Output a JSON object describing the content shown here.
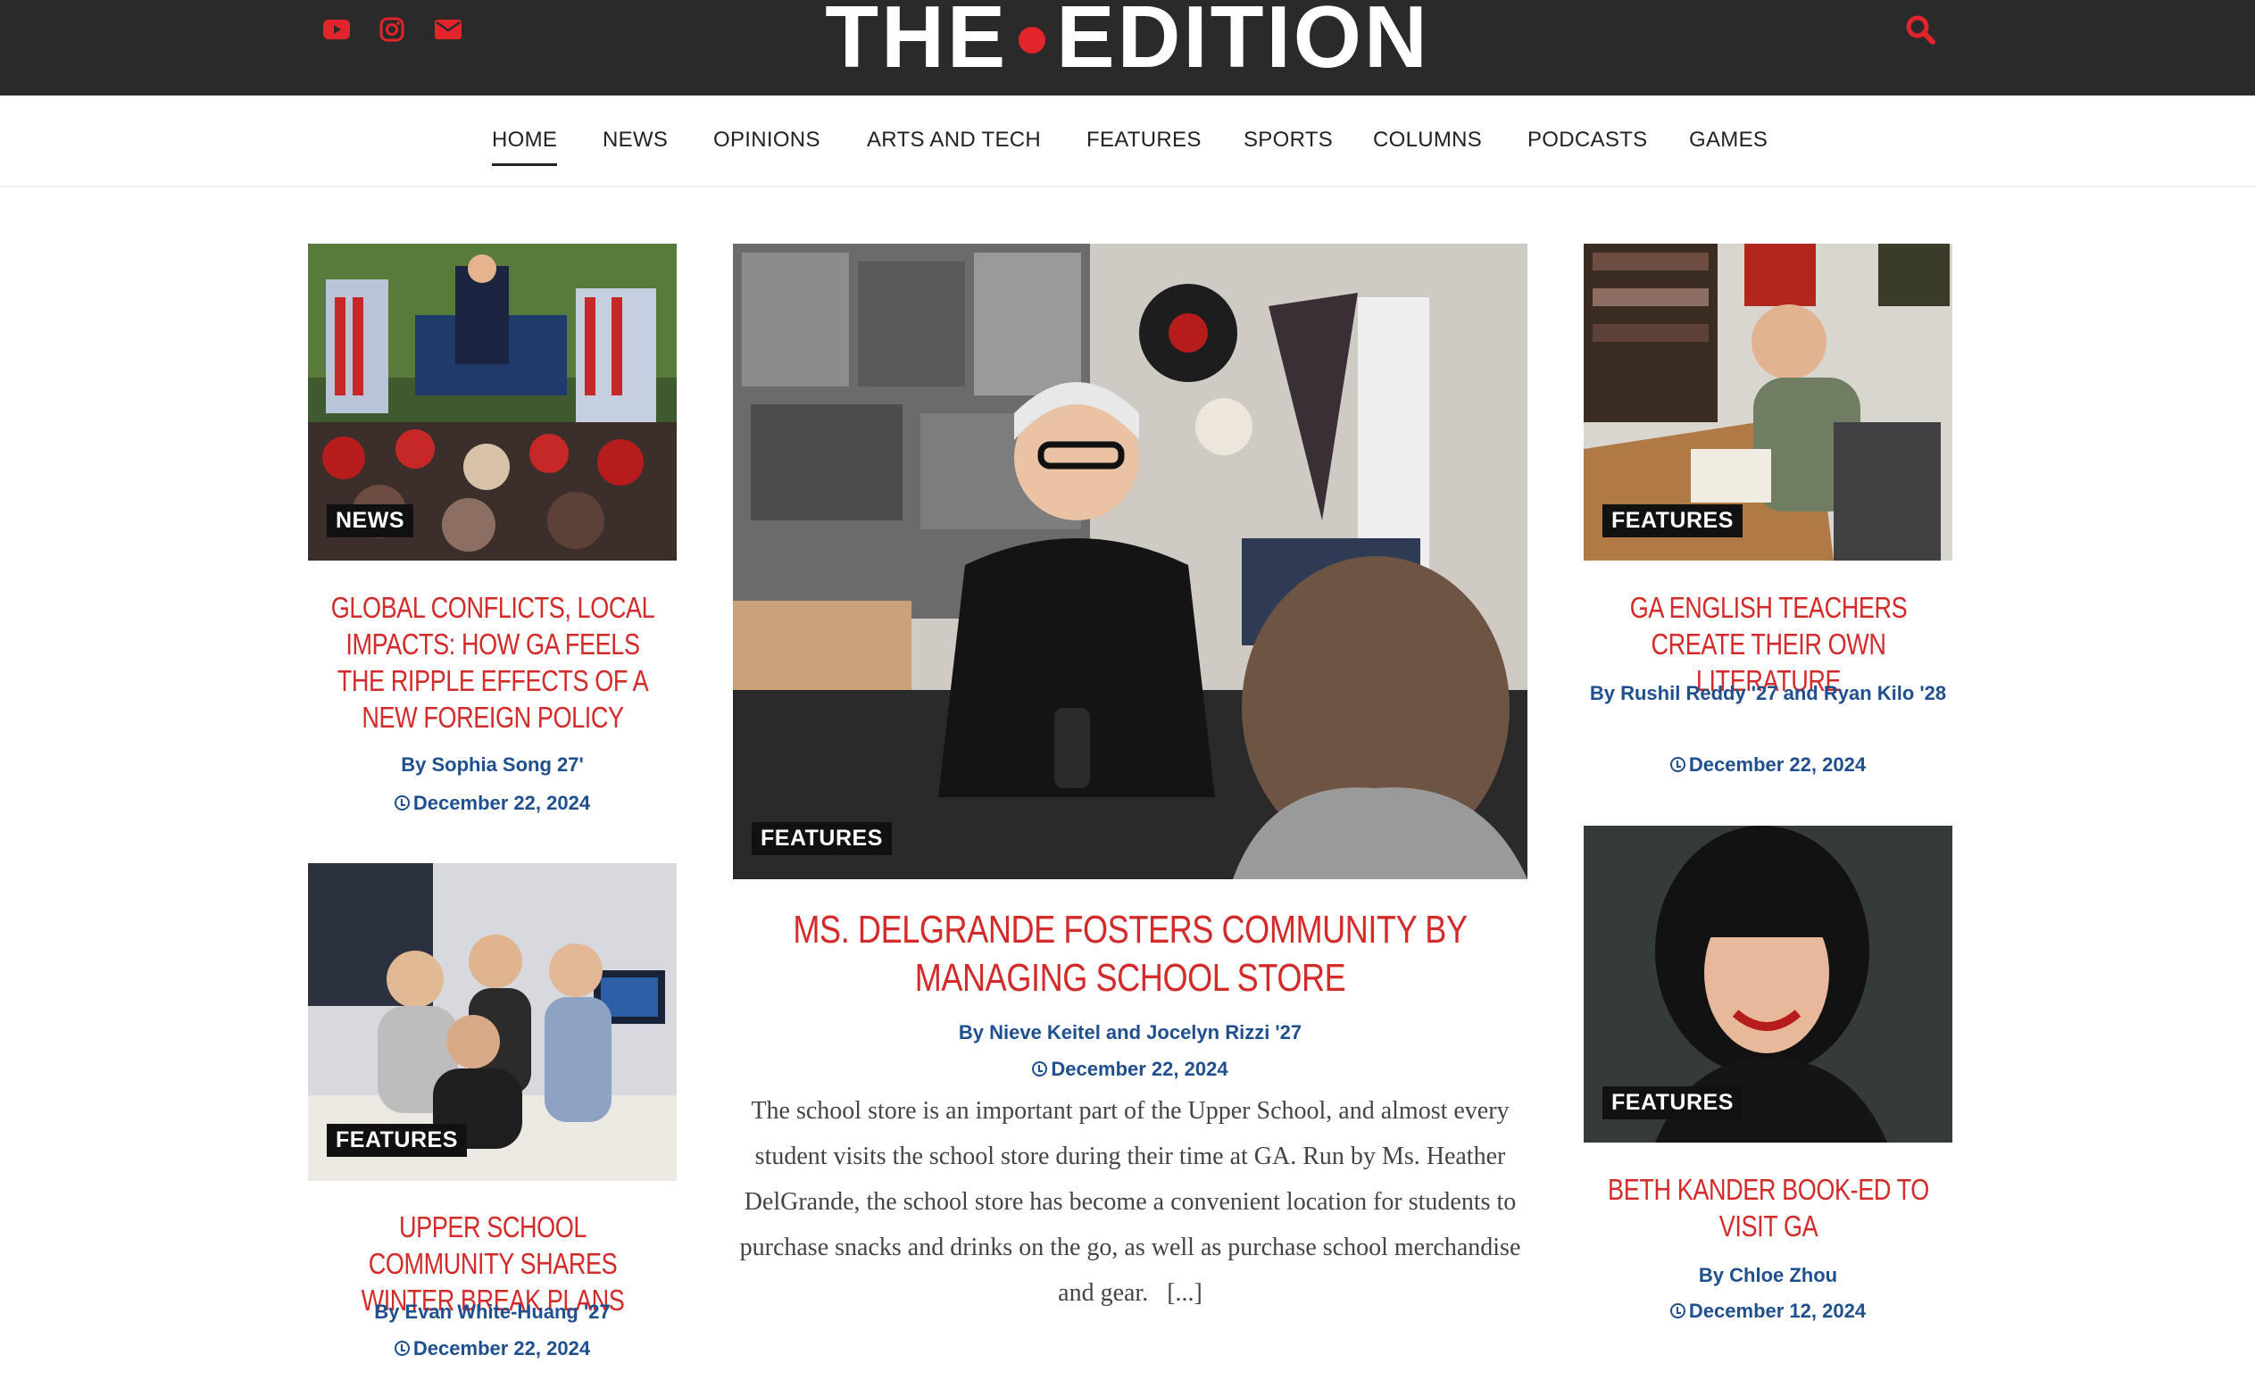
{
  "header": {
    "logo_left": "THE",
    "logo_right": "EDITION",
    "social": [
      "youtube-icon",
      "instagram-icon",
      "email-icon"
    ],
    "colors": {
      "bar": "#2b2a2a",
      "accent": "#e2242b",
      "headline": "#d32a2a",
      "meta": "#1f4f8f"
    }
  },
  "nav": {
    "items": [
      "HOME",
      "NEWS",
      "OPINIONS",
      "ARTS AND TECH",
      "FEATURES",
      "SPORTS",
      "COLUMNS",
      "PODCASTS",
      "GAMES"
    ],
    "active": "HOME"
  },
  "articles": {
    "left1": {
      "category": "NEWS",
      "title": "GLOBAL CONFLICTS, LOCAL IMPACTS: HOW GA FEELS THE RIPPLE EFFECTS OF A NEW FOREIGN POLICY",
      "byline": "By Sophia Song 27'",
      "date": "December 22, 2024"
    },
    "left2": {
      "category": "FEATURES",
      "title": "UPPER SCHOOL COMMUNITY SHARES WINTER BREAK PLANS",
      "byline": "By Evan White-Huang '27",
      "date": "December 22, 2024"
    },
    "center": {
      "category": "FEATURES",
      "title": "MS. DELGRANDE FOSTERS COMMUNITY BY MANAGING SCHOOL STORE",
      "byline": "By Nieve Keitel and Jocelyn Rizzi '27",
      "date": "December 22, 2024",
      "excerpt": "The school store is an important part of the Upper School, and almost every student visits the school store during their time at GA. Run by Ms. Heather DelGrande, the school store has become a convenient location for students to purchase snacks and drinks on the go, as well as purchase school merchandise and gear.",
      "more": "[...]"
    },
    "right1": {
      "category": "FEATURES",
      "title": "GA ENGLISH TEACHERS CREATE THEIR OWN LITERATURE",
      "byline": "By Rushil Reddy '27 and Ryan Kilo '28",
      "date": "December 22, 2024"
    },
    "right2": {
      "category": "FEATURES",
      "title": "BETH KANDER BOOK-ED TO VISIT GA",
      "byline": "By Chloe Zhou",
      "date": "December 12, 2024"
    }
  }
}
